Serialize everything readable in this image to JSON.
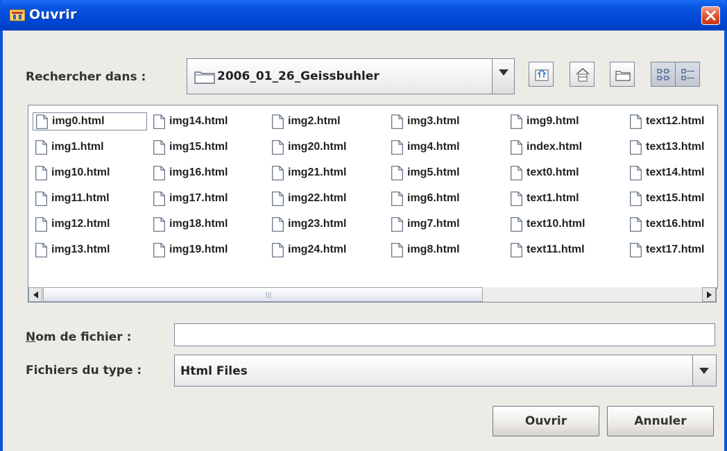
{
  "window": {
    "title": "Ouvrir"
  },
  "look_in": {
    "label": "Rechercher dans :",
    "value": "2006_01_26_Geissbuhler"
  },
  "toolbar": {
    "buttons": [
      "up-one-level-icon",
      "home-icon",
      "new-folder-icon",
      "list-view-icon",
      "details-view-icon"
    ],
    "active": "list-view-icon"
  },
  "files": {
    "columns": [
      [
        "img0.html",
        "img1.html",
        "img10.html",
        "img11.html",
        "img12.html",
        "img13.html"
      ],
      [
        "img14.html",
        "img15.html",
        "img16.html",
        "img17.html",
        "img18.html",
        "img19.html"
      ],
      [
        "img2.html",
        "img20.html",
        "img21.html",
        "img22.html",
        "img23.html",
        "img24.html"
      ],
      [
        "img3.html",
        "img4.html",
        "img5.html",
        "img6.html",
        "img7.html",
        "img8.html"
      ],
      [
        "img9.html",
        "index.html",
        "text0.html",
        "text1.html",
        "text10.html",
        "text11.html"
      ],
      [
        "text12.html",
        "text13.html",
        "text14.html",
        "text15.html",
        "text16.html",
        "text17.html"
      ]
    ],
    "selected": "img0.html"
  },
  "filename": {
    "label": "Nom de fichier :",
    "value": ""
  },
  "filetype": {
    "label": "Fichiers du type :",
    "value": "Html Files"
  },
  "buttons": {
    "open": "Ouvrir",
    "cancel": "Annuler"
  },
  "colors": {
    "titlebar": "#0a55e0",
    "window_bg": "#ecebe6",
    "close": "#e0502a"
  }
}
